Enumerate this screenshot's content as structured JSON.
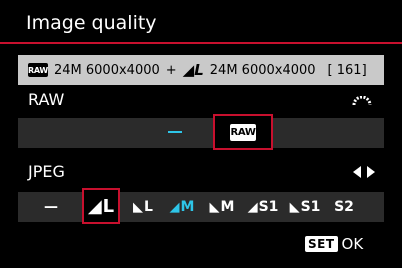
{
  "title": "Image quality",
  "summary": {
    "raw_icon": "RAW",
    "raw_text": "24M 6000x4000",
    "plus": "+",
    "jpeg_icon": "L",
    "jpeg_text": "24M 6000x4000",
    "shots": "[ 161]"
  },
  "raw_section": {
    "label": "RAW",
    "options": [
      "—",
      "RAW"
    ],
    "selected": "RAW"
  },
  "jpeg_section": {
    "label": "JPEG",
    "options": [
      {
        "label": "—"
      },
      {
        "label": "L",
        "quality": "fine"
      },
      {
        "label": "L",
        "quality": "normal"
      },
      {
        "label": "M",
        "quality": "fine"
      },
      {
        "label": "M",
        "quality": "normal"
      },
      {
        "label": "S1",
        "quality": "fine"
      },
      {
        "label": "S1",
        "quality": "normal"
      },
      {
        "label": "S2"
      }
    ],
    "selected_index": 1
  },
  "footer": {
    "set_label": "SET",
    "ok_label": "OK"
  },
  "colors": {
    "accent": "#c8102e",
    "highlight": "#2ec5e8",
    "band": "#2b2b2b",
    "summary_bg": "#c9c9c9"
  },
  "icons": [
    "main-dial-icon",
    "left-right-arrows-icon",
    "fine-quality-icon",
    "normal-quality-icon"
  ]
}
